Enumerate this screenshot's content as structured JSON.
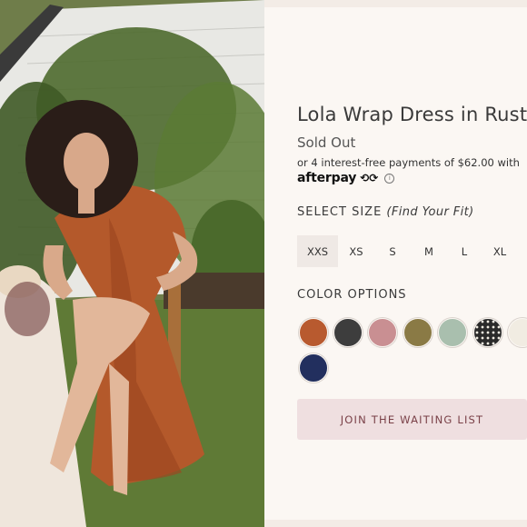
{
  "product": {
    "title": "Lola Wrap Dress in Rust",
    "status": "Sold Out",
    "payments_text": "or 4 interest-free payments of $62.00 with",
    "afterpay_logo": "afterpay",
    "afterpay_mark": "⟲⟳"
  },
  "size": {
    "heading": "SELECT SIZE",
    "fit_link": "(Find Your Fit)",
    "options": [
      "XXS",
      "XS",
      "S",
      "M",
      "L",
      "XL"
    ],
    "selected": "XXS"
  },
  "color": {
    "heading": "COLOR OPTIONS",
    "swatches": [
      {
        "name": "rust",
        "color": "#b85a2f"
      },
      {
        "name": "charcoal",
        "color": "#3d3d3d"
      },
      {
        "name": "dusty-rose",
        "color": "#c98f92"
      },
      {
        "name": "olive",
        "color": "#8a7a45"
      },
      {
        "name": "sage",
        "color": "#a9bfae"
      },
      {
        "name": "black-polka-dot",
        "color": "#2a2a2a"
      },
      {
        "name": "ivory",
        "color": "#f1ece2"
      },
      {
        "name": "navy",
        "color": "#222f5e"
      }
    ]
  },
  "actions": {
    "waitlist_label": "JOIN THE WAITING LIST"
  }
}
